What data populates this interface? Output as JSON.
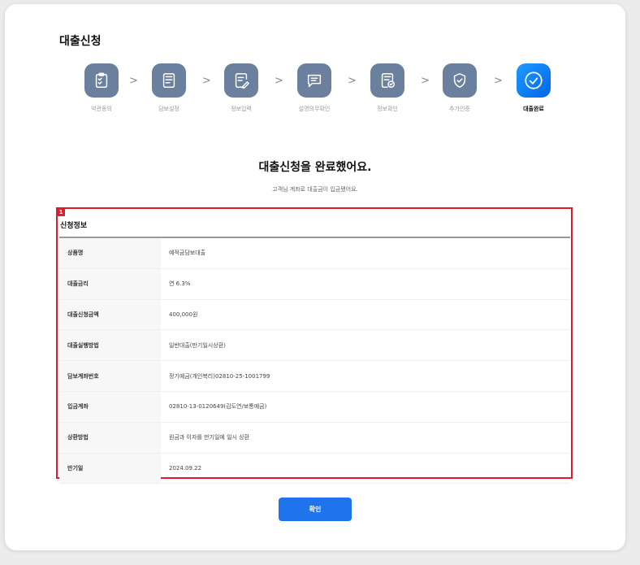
{
  "page": {
    "title": "대출신청"
  },
  "steps": [
    {
      "label": "약관동의",
      "icon": "clipboard-check-icon"
    },
    {
      "label": "담보설정",
      "icon": "document-icon"
    },
    {
      "label": "정보입력",
      "icon": "document-edit-icon"
    },
    {
      "label": "설명의무확인",
      "icon": "chat-message-icon"
    },
    {
      "label": "정보확인",
      "icon": "document-verified-icon"
    },
    {
      "label": "추가인증",
      "icon": "shield-check-icon"
    },
    {
      "label": "대출완료",
      "icon": "check-circle-icon"
    }
  ],
  "active_step": 7,
  "completion": {
    "title": "대출신청을 완료했어요.",
    "subtitle": "고객님 계좌로 대출금이 입금됐어요."
  },
  "info": {
    "badge": "1",
    "title": "신청정보",
    "rows": [
      {
        "key": "상품명",
        "value": "예적금담보대출"
      },
      {
        "key": "대출금리",
        "value": "연 6.3%"
      },
      {
        "key": "대출신청금액",
        "value": "400,000원"
      },
      {
        "key": "대출실행방법",
        "value": "일반대출(만기일시상환)"
      },
      {
        "key": "담보계좌번호",
        "value": "정기예금(개인복리)02810-25-1001799"
      },
      {
        "key": "입금계좌",
        "value": "02810-13-0120649(김도연/보통예금)"
      },
      {
        "key": "상환방법",
        "value": "원금과 이자를 만기일에 일시 상환"
      },
      {
        "key": "만기일",
        "value": "2024.09.22"
      }
    ]
  },
  "buttons": {
    "confirm": "확인"
  },
  "colors": {
    "step_icon": "#6a809e",
    "active_step": "#1f8bff",
    "primary_button": "#1f74ed",
    "highlight": "#e21b2b"
  }
}
